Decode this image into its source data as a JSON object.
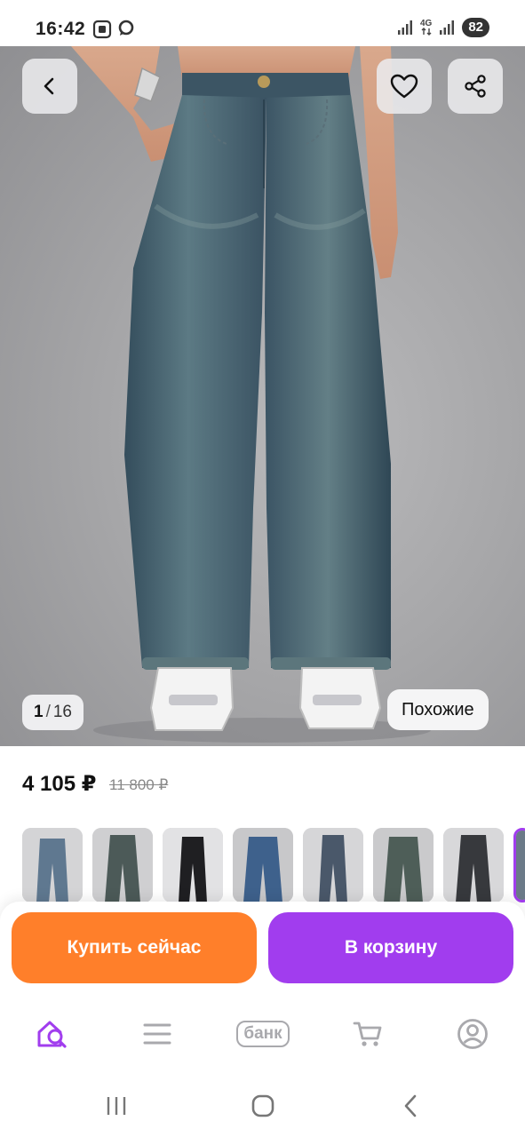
{
  "status_bar": {
    "time": "16:42",
    "network": "4G",
    "battery": "82",
    "icons": [
      "screenshot-icon",
      "chat-bubble-icon",
      "signal-icon",
      "data-arrows-icon",
      "signal-icon"
    ]
  },
  "product": {
    "image_counter": {
      "current": "1",
      "separator": "/",
      "total": "16"
    },
    "similar_label": "Похожие",
    "price": "4 105 ₽",
    "old_price": "11 800 ₽",
    "thumbnails": [
      {
        "tone": "#5f7890"
      },
      {
        "tone": "#4c5a58"
      },
      {
        "tone": "#1f1f22"
      },
      {
        "tone": "#3e618c"
      },
      {
        "tone": "#4a586a"
      },
      {
        "tone": "#4e5e58"
      },
      {
        "tone": "#37393d"
      },
      {
        "tone": "#6b7a88"
      }
    ]
  },
  "actions": {
    "buy_now": "Купить сейчас",
    "add_to_cart": "В корзину"
  },
  "bottom_nav": {
    "items": [
      {
        "icon": "home-search-icon",
        "active": true
      },
      {
        "icon": "catalog-menu-icon",
        "active": false
      },
      {
        "label": "банк",
        "active": false
      },
      {
        "icon": "cart-icon",
        "active": false
      },
      {
        "icon": "profile-icon",
        "active": false
      }
    ]
  },
  "colors": {
    "accent_orange": "#ff7f2a",
    "accent_purple": "#a13dee",
    "nav_active": "#a13dee",
    "nav_inactive": "#a9a9ad"
  }
}
